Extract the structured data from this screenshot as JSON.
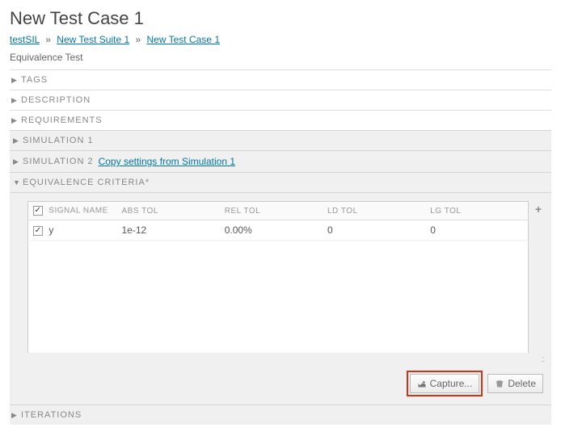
{
  "page_title": "New Test Case 1",
  "breadcrumb": {
    "crumb0": "testSIL",
    "crumb1": "New Test Suite 1",
    "crumb2": "New Test Case 1",
    "sep": "»"
  },
  "subtitle": "Equivalence Test",
  "sections": {
    "tags": "TAGS",
    "description": "DESCRIPTION",
    "requirements": "REQUIREMENTS",
    "sim1": "SIMULATION 1",
    "sim2": "SIMULATION 2",
    "sim2_link": "Copy settings from Simulation 1",
    "equiv": "EQUIVALENCE CRITERIA*",
    "iterations": "ITERATIONS"
  },
  "table": {
    "headers": {
      "signal": "SIGNAL NAME",
      "abs": "ABS TOL",
      "rel": "REL TOL",
      "ld": "LD TOL",
      "lg": "LG TOL"
    },
    "row0": {
      "signal": "y",
      "abs": "1e-12",
      "rel": "0.00%",
      "ld": "0",
      "lg": "0"
    }
  },
  "buttons": {
    "capture": "Capture...",
    "delete": "Delete"
  },
  "glyphs": {
    "closed": "▶",
    "open": "▼",
    "check": "✓",
    "plus": "+"
  }
}
